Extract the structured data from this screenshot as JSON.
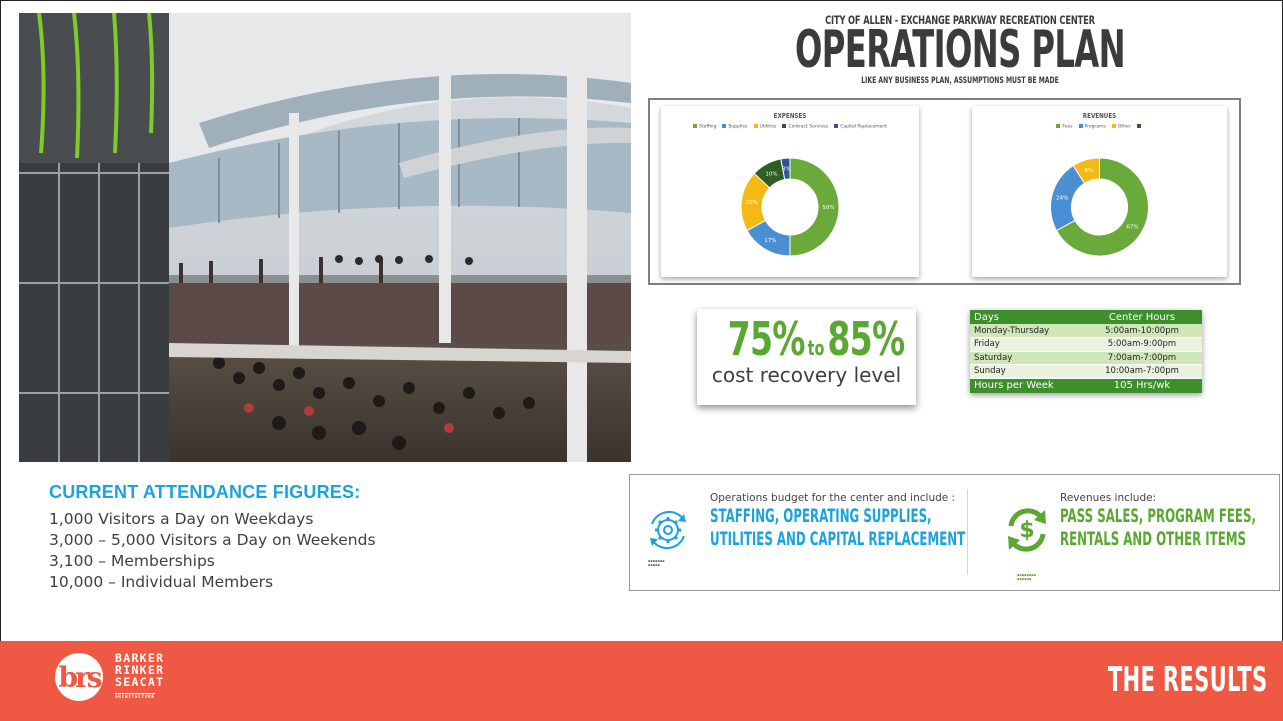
{
  "ops_plan": {
    "subtitle": "CITY OF ALLEN - EXCHANGE PARKWAY RECREATION CENTER",
    "title": "OPERATIONS PLAN",
    "tagline": "LIKE ANY BUSINESS PLAN, ASSUMPTIONS MUST BE MADE"
  },
  "chart_data": [
    {
      "type": "pie",
      "title": "EXPENSES",
      "labels": [
        "Staffing",
        "Supplies",
        "Utilities",
        "Contract Services",
        "Capital Replacement"
      ],
      "values": [
        50,
        17,
        20,
        10,
        3
      ],
      "value_labels": [
        "50%",
        "17%",
        "20%",
        "10%",
        "3%"
      ],
      "colors": [
        "#6aaa3a",
        "#4a8fd4",
        "#f5b915",
        "#2e5e22",
        "#2f5597"
      ],
      "donut": true,
      "legend": "top"
    },
    {
      "type": "pie",
      "title": "REVENUES",
      "labels": [
        "Fees",
        "Programs",
        "Other",
        ""
      ],
      "values": [
        67,
        24,
        9
      ],
      "value_labels": [
        "67%",
        "24%",
        "9%"
      ],
      "colors": [
        "#6aaa3a",
        "#4a8fd4",
        "#f5b915",
        "#2e5e22"
      ],
      "donut": true,
      "legend": "top"
    }
  ],
  "recovery": {
    "low": "75%",
    "to": "to",
    "high": "85%",
    "caption": "cost recovery level"
  },
  "hours_table": {
    "headers": [
      "Days",
      "Center Hours"
    ],
    "rows": [
      [
        "Monday-Thursday",
        "5:00am-10:00pm"
      ],
      [
        "Friday",
        "5:00am-9:00pm"
      ],
      [
        "Saturday",
        "7:00am-7:00pm"
      ],
      [
        "Sunday",
        "10:00am-7:00pm"
      ]
    ],
    "footer": [
      "Hours per Week",
      "105 Hrs/wk"
    ]
  },
  "budget": {
    "left_intro": "Operations budget for the center and include :",
    "left_line1": "STAFFING, OPERATING SUPPLIES,",
    "left_line2": "UTILITIES AND CAPITAL REPLACEMENT",
    "right_intro": "Revenues include:",
    "right_line1": "PASS SALES, PROGRAM FEES,",
    "right_line2": "RENTALS AND OTHER ITEMS",
    "gear_icon": "gear-refresh-icon",
    "dollar_icon": "dollar-refresh-icon"
  },
  "attendance": {
    "heading": "CURRENT ATTENDANCE FIGURES:",
    "lines": [
      "1,000 Visitors a Day on Weekdays",
      "3,000 – 5,000 Visitors a Day on Weekends",
      "3,100 – Memberships",
      "10,000 – Individual Members"
    ]
  },
  "footer": {
    "firm_lines": [
      "BARKER",
      "RINKER",
      "SEACAT"
    ],
    "firm_sub": "ARCHITECTURE",
    "logo_letters": "brs",
    "section": "THE RESULTS",
    "bg_color": "#ef5843"
  }
}
